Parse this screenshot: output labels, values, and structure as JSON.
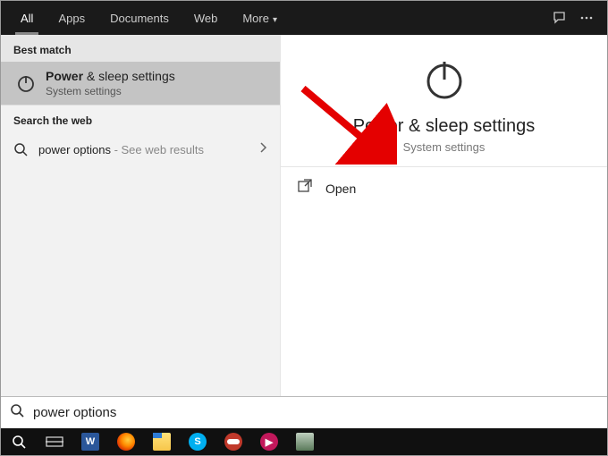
{
  "tabs": {
    "all": "All",
    "apps": "Apps",
    "documents": "Documents",
    "web": "Web",
    "more": "More"
  },
  "left": {
    "best_match_header": "Best match",
    "result": {
      "title_bold": "Power",
      "title_rest": " & sleep settings",
      "subtitle": "System settings"
    },
    "search_web_header": "Search the web",
    "web_result": {
      "query": "power options",
      "suffix": " - See web results"
    }
  },
  "right": {
    "title": "Power & sleep settings",
    "subtitle": "System settings",
    "open_label": "Open"
  },
  "search": {
    "value": "power options"
  },
  "taskbar": {
    "apps": [
      {
        "name": "task-view-icon"
      },
      {
        "name": "word-icon"
      },
      {
        "name": "firefox-icon"
      },
      {
        "name": "file-explorer-icon"
      },
      {
        "name": "skype-icon"
      },
      {
        "name": "spectacles-icon"
      },
      {
        "name": "pink-app-icon"
      },
      {
        "name": "printer-icon"
      }
    ]
  }
}
